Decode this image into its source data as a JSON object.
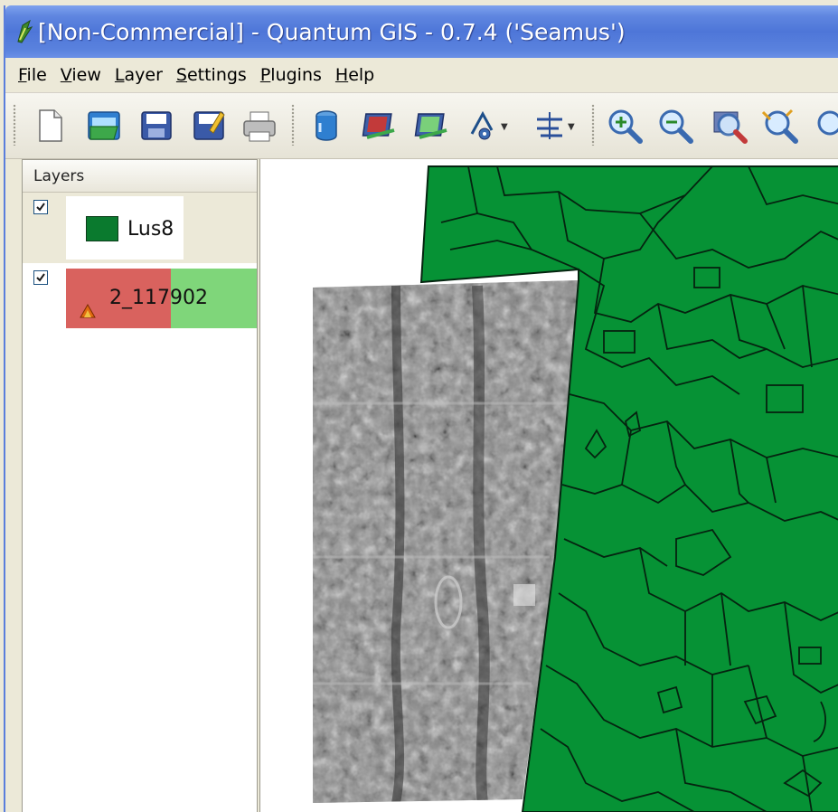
{
  "window": {
    "title": "[Non-Commercial] - Quantum GIS - 0.7.4 ('Seamus')"
  },
  "menu": [
    {
      "first": "F",
      "rest": "ile"
    },
    {
      "first": "V",
      "rest": "iew"
    },
    {
      "first": "L",
      "rest": "ayer"
    },
    {
      "first": "S",
      "rest": "ettings"
    },
    {
      "first": "P",
      "rest": "lugins"
    },
    {
      "first": "H",
      "rest": "elp"
    }
  ],
  "toolbar": {
    "buttons": [
      "new-project-icon",
      "open-project-icon",
      "save-project-icon",
      "save-as-icon",
      "print-icon",
      "add-vector-layer-icon",
      "add-raster-layer-icon",
      "add-layer-icon",
      "capture-point-icon",
      "capture-line-icon",
      "zoom-in-icon",
      "zoom-out-icon",
      "zoom-full-icon",
      "zoom-selected-icon"
    ]
  },
  "layers": {
    "header": "Layers",
    "items": [
      {
        "name": "Lus8",
        "checked": true,
        "type": "vector",
        "color": "#0a7a2e"
      },
      {
        "name": "2_117902",
        "checked": true,
        "type": "raster"
      }
    ]
  },
  "colors": {
    "vector_fill": "#069235",
    "vector_outline": "#052410",
    "raster_selection_left": "#d9625e",
    "raster_selection_right": "#7fd67a",
    "titlebar": "#5a82de"
  }
}
